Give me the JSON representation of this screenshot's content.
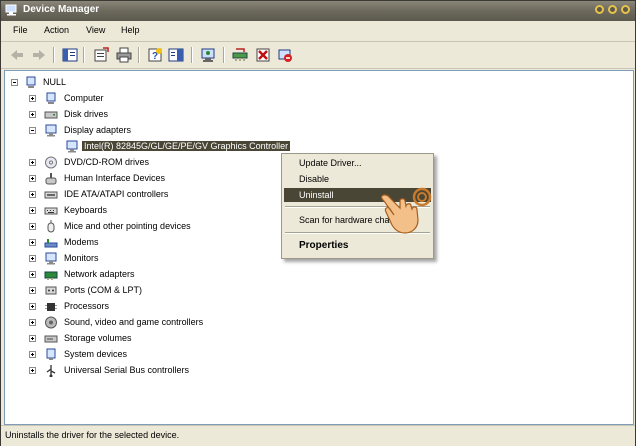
{
  "window": {
    "title": "Device Manager"
  },
  "menu": [
    "File",
    "Action",
    "View",
    "Help"
  ],
  "tree": {
    "root": "NULL",
    "categories": [
      {
        "label": "Computer",
        "icon": "computer-icon",
        "expanded": false
      },
      {
        "label": "Disk drives",
        "icon": "disk-drive-icon",
        "expanded": false
      },
      {
        "label": "Display adapters",
        "icon": "monitor-icon",
        "expanded": true
      },
      {
        "label": "DVD/CD-ROM drives",
        "icon": "cdrom-icon",
        "expanded": false
      },
      {
        "label": "Human Interface Devices",
        "icon": "hid-icon",
        "expanded": false
      },
      {
        "label": "IDE ATA/ATAPI controllers",
        "icon": "ide-controller-icon",
        "expanded": false
      },
      {
        "label": "Keyboards",
        "icon": "keyboard-icon",
        "expanded": false
      },
      {
        "label": "Mice and other pointing devices",
        "icon": "mouse-icon",
        "expanded": false
      },
      {
        "label": "Modems",
        "icon": "modem-icon",
        "expanded": false
      },
      {
        "label": "Monitors",
        "icon": "monitor-icon",
        "expanded": false
      },
      {
        "label": "Network adapters",
        "icon": "network-adapter-icon",
        "expanded": false
      },
      {
        "label": "Ports (COM & LPT)",
        "icon": "port-icon",
        "expanded": false
      },
      {
        "label": "Processors",
        "icon": "processor-icon",
        "expanded": false
      },
      {
        "label": "Sound, video and game controllers",
        "icon": "speaker-icon",
        "expanded": false
      },
      {
        "label": "Storage volumes",
        "icon": "storage-volume-icon",
        "expanded": false
      },
      {
        "label": "System devices",
        "icon": "system-device-icon",
        "expanded": false
      },
      {
        "label": "Universal Serial Bus controllers",
        "icon": "usb-icon",
        "expanded": false
      }
    ],
    "display_child": "Intel(R) 82845G/GL/GE/PE/GV Graphics Controller"
  },
  "context_menu": {
    "update_driver": "Update Driver...",
    "disable": "Disable",
    "uninstall": "Uninstall",
    "scan": "Scan for hardware cha",
    "properties": "Properties"
  },
  "status": "Uninstalls the driver for the selected device.",
  "colors": {
    "selection": "#4a4636",
    "titlebar": "#6e6b5f",
    "face": "#ece9d8"
  }
}
